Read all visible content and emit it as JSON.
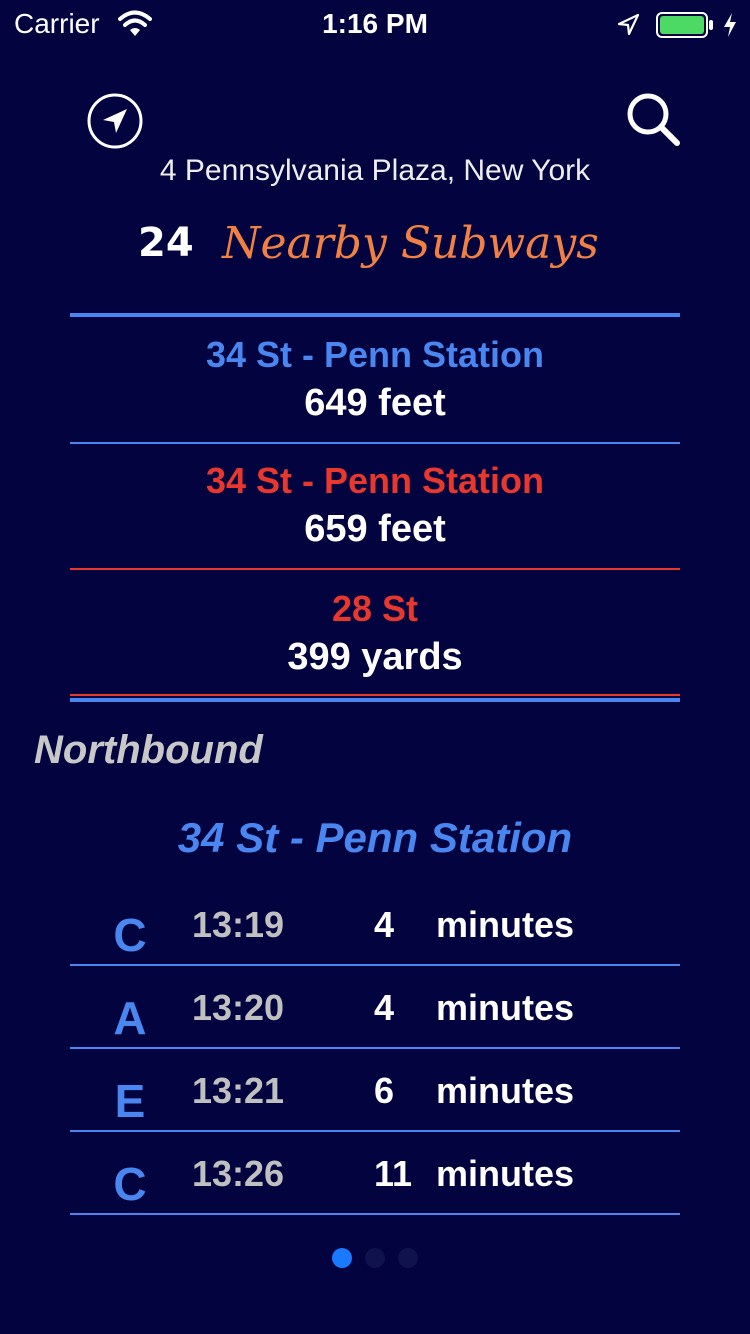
{
  "status_bar": {
    "carrier": "Carrier",
    "time": "1:16 PM"
  },
  "header": {
    "address": "4 Pennsylvania Plaza,  New York",
    "count": "24",
    "title": "Nearby Subways"
  },
  "stations": [
    {
      "name": "34 St - Penn Station",
      "distance": "649  feet",
      "color": "#4a86f0"
    },
    {
      "name": "34 St - Penn Station",
      "distance": "659  feet",
      "color": "#e8382e"
    },
    {
      "name": "28 St",
      "distance": "399  yards",
      "color": "#e8382e"
    }
  ],
  "direction": {
    "label": "Northbound",
    "station": "34 St - Penn Station",
    "arrivals": [
      {
        "line": "C",
        "time": "13:19",
        "minutes": "4",
        "unit": "minutes"
      },
      {
        "line": "A",
        "time": "13:20",
        "minutes": "4",
        "unit": "minutes"
      },
      {
        "line": "E",
        "time": "13:21",
        "minutes": "6",
        "unit": "minutes"
      },
      {
        "line": "C",
        "time": "13:26",
        "minutes": "11",
        "unit": "minutes"
      }
    ]
  },
  "pager": {
    "pages": 3,
    "current": 1
  },
  "colors": {
    "background": "#02033f",
    "accent_blue": "#4a86f0",
    "accent_red": "#e8382e",
    "title_orange": "#f08044",
    "pager_active": "#1a7aff",
    "pager_inactive": "#10124e"
  }
}
